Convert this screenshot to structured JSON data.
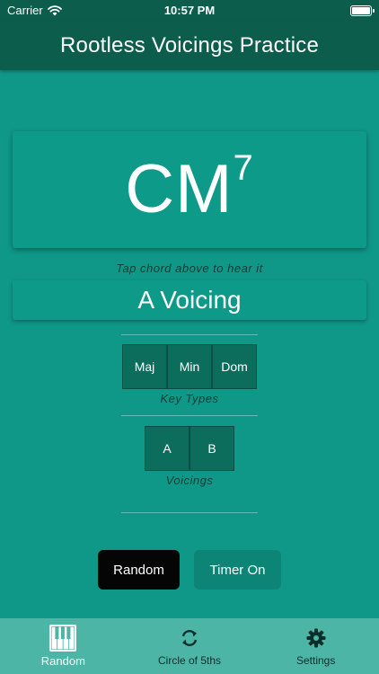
{
  "status_bar": {
    "carrier": "Carrier",
    "time": "10:57 PM"
  },
  "nav": {
    "title": "Rootless Voicings Practice"
  },
  "chord": {
    "name": "CM",
    "extension": "7"
  },
  "hint": "Tap chord above to hear it",
  "voicing_display": "A Voicing",
  "key_types": {
    "options": [
      "Maj",
      "Min",
      "Dom"
    ],
    "label": "Key Types"
  },
  "voicings": {
    "options": [
      "A",
      "B"
    ],
    "label": "Voicings"
  },
  "actions": {
    "random_label": "Random",
    "timer_label": "Timer On"
  },
  "tab_bar": {
    "tabs": [
      {
        "label": "Random",
        "icon": "piano-icon",
        "active": true
      },
      {
        "label": "Circle of 5ths",
        "icon": "refresh-icon",
        "active": false
      },
      {
        "label": "Settings",
        "icon": "gear-icon",
        "active": false
      }
    ]
  },
  "colors": {
    "background": "#0f9787",
    "header": "#0d5d4d",
    "segment": "#0d6d5d",
    "tab_bar": "#4db5a6",
    "random_button": "#050505",
    "timer_button": "#0c8576"
  }
}
